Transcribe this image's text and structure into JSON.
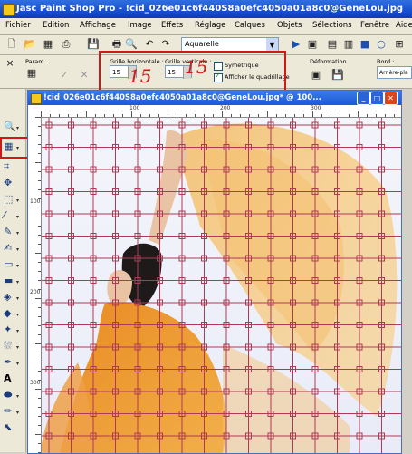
{
  "app": {
    "title": "Jasc Paint Shop Pro - !cid_026e01c6f440S8a0efc4050a01a8c0@GeneLou.jpg"
  },
  "menu": [
    "Fichier",
    "Edition",
    "Affichage",
    "Image",
    "Effets",
    "Réglage",
    "Calques",
    "Objets",
    "Sélections",
    "Fenêtre",
    "Aide"
  ],
  "toolbar": {
    "brush_value": "Aquarelle"
  },
  "options": {
    "params_label": "Param.",
    "grille_h_label": "Grille horizontale :",
    "grille_v_label": "Grille verticale :",
    "grille_h_value": "15",
    "grille_v_value": "15",
    "symetrique_label": "Symétrique",
    "symetrique_checked": false,
    "afficher_label": "Afficher le quadrillage",
    "afficher_checked": true,
    "deformation_label": "Déformation",
    "bord_label": "Bord :",
    "bord_value": "Arrière-pla"
  },
  "annotations": {
    "h_number": "15",
    "v_number": "15",
    "color": "#d01818"
  },
  "image_window": {
    "title": "!cid_026e01c6f440S8a0efc4050a01a8c0@GeneLou.jpg* @ 100..."
  },
  "ruler": {
    "top_labels": [
      "100",
      "200",
      "300"
    ],
    "left_labels": [
      "100",
      "200",
      "300"
    ]
  },
  "grid": {
    "color": "#b03a55"
  }
}
